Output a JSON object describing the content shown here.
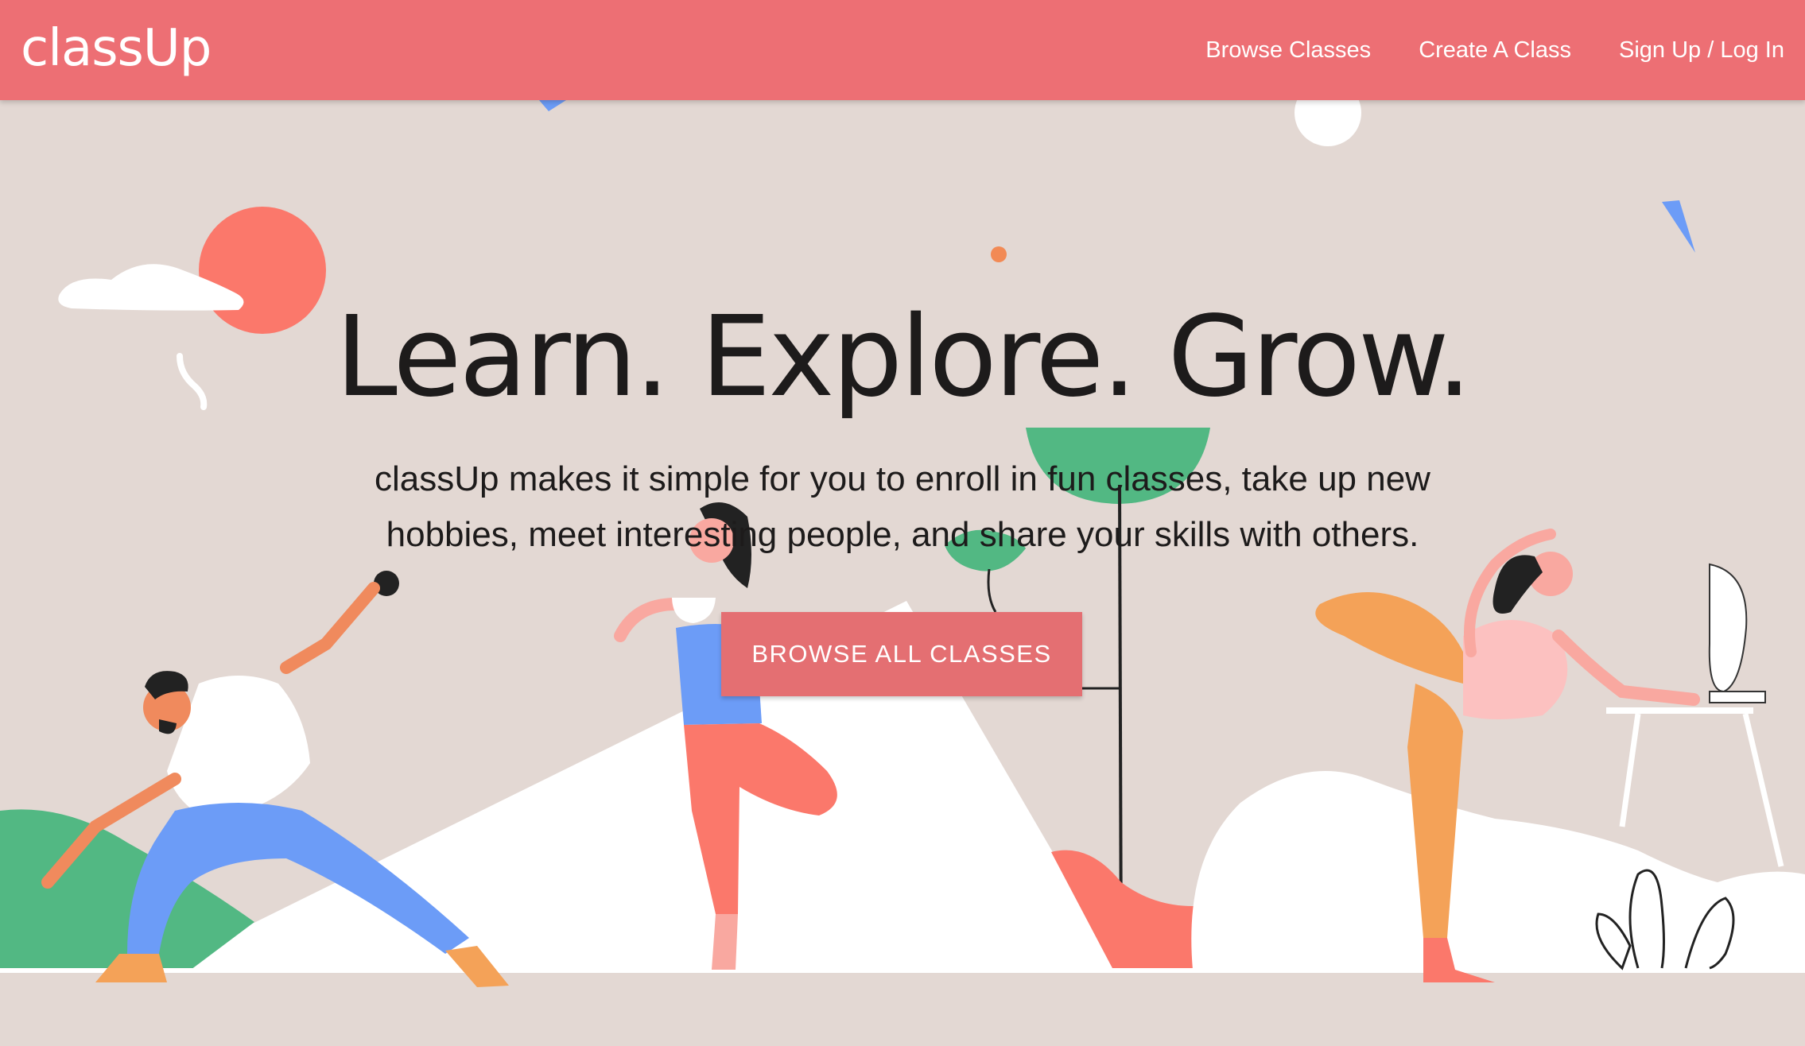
{
  "navbar": {
    "brand": "classUp",
    "links": [
      {
        "label": "Browse Classes"
      },
      {
        "label": "Create A Class"
      },
      {
        "label": "Sign Up / Log In"
      }
    ]
  },
  "hero": {
    "title": "Learn. Explore. Grow.",
    "subtitle": "classUp makes it simple for you to enroll in fun classes, take up new hobbies, meet interesting people, and share your skills with others.",
    "cta_label": "BROWSE ALL CLASSES"
  },
  "colors": {
    "navbar": "#ed6f74",
    "background": "#e3d8d3",
    "button": "#e46f72",
    "accent_green": "#52b883",
    "accent_blue": "#6c9cf7",
    "accent_orange": "#f4a258"
  }
}
